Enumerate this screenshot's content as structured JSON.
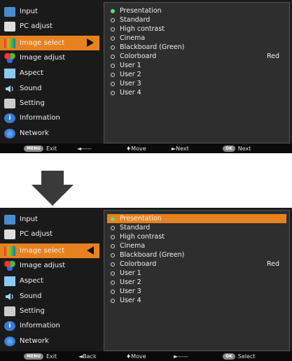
{
  "top": {
    "menu": [
      {
        "label": "Input",
        "icon": "input-icon"
      },
      {
        "label": "PC adjust",
        "icon": "pc-adjust-icon"
      },
      {
        "label": "Image select",
        "icon": "image-select-icon"
      },
      {
        "label": "Image adjust",
        "icon": "image-adjust-icon"
      },
      {
        "label": "Aspect",
        "icon": "aspect-icon"
      },
      {
        "label": "Sound",
        "icon": "sound-icon"
      },
      {
        "label": "Setting",
        "icon": "setting-icon"
      },
      {
        "label": "Information",
        "icon": "information-icon"
      },
      {
        "label": "Network",
        "icon": "network-icon"
      }
    ],
    "options": [
      "Presentation",
      "Standard",
      "High contrast",
      "Cinema",
      "Blackboard (Green)",
      "Colorboard",
      "User 1",
      "User 2",
      "User 3",
      "User 4"
    ],
    "colorboard_value": "Red",
    "footer": {
      "exit_pill": "MENU",
      "exit": "Exit",
      "back": "◄-----",
      "move": "♦Move",
      "next": "►Next",
      "ok_pill": "OK",
      "ok": "Next"
    }
  },
  "bottom": {
    "menu": [
      {
        "label": "Input",
        "icon": "input-icon"
      },
      {
        "label": "PC adjust",
        "icon": "pc-adjust-icon"
      },
      {
        "label": "Image select",
        "icon": "image-select-icon"
      },
      {
        "label": "Image adjust",
        "icon": "image-adjust-icon"
      },
      {
        "label": "Aspect",
        "icon": "aspect-icon"
      },
      {
        "label": "Sound",
        "icon": "sound-icon"
      },
      {
        "label": "Setting",
        "icon": "setting-icon"
      },
      {
        "label": "Information",
        "icon": "information-icon"
      },
      {
        "label": "Network",
        "icon": "network-icon"
      }
    ],
    "options": [
      "Presentation",
      "Standard",
      "High contrast",
      "Cinema",
      "Blackboard (Green)",
      "Colorboard",
      "User 1",
      "User 2",
      "User 3",
      "User 4"
    ],
    "colorboard_value": "Red",
    "footer": {
      "exit_pill": "MENU",
      "exit": "Exit",
      "back": "◄Back",
      "move": "♦Move",
      "next": "►-----",
      "ok_pill": "OK",
      "ok": "Select"
    }
  },
  "colors": {
    "accent": "#e8821e",
    "selected_radio": "#5fe06a",
    "panel": "#2e2e2e",
    "background": "#1a1a1a"
  }
}
